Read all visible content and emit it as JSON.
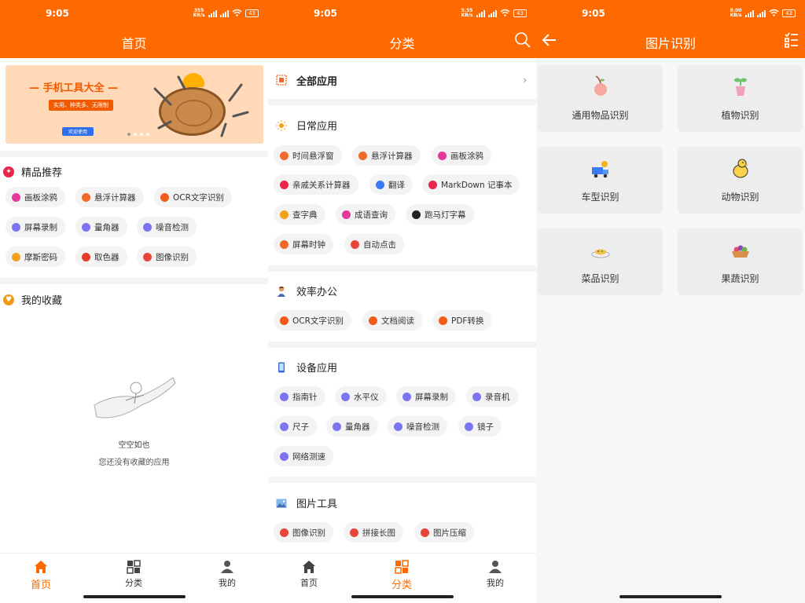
{
  "status": {
    "time": "9:05",
    "net1": "355 KB/s",
    "net2": "5.55 KB/s",
    "net3": "8.00 KB/s",
    "battery": "43"
  },
  "home": {
    "title": "首页",
    "banner": {
      "title": "— 手机工具大全 —",
      "subtitle": "实用、种类多、无限制",
      "button": "欢迎使用"
    },
    "featured": {
      "title": "精品推荐",
      "items": [
        {
          "label": "画板涂鸦",
          "color": "#e8379a"
        },
        {
          "label": "悬浮计算器",
          "color": "#f26a2a"
        },
        {
          "label": "OCR文字识别",
          "color": "#f25a1a"
        },
        {
          "label": "屏幕录制",
          "color": "#7b73f0"
        },
        {
          "label": "量角器",
          "color": "#7b73f0"
        },
        {
          "label": "噪音检测",
          "color": "#7b73f0"
        },
        {
          "label": "摩斯密码",
          "color": "#f2a21a"
        },
        {
          "label": "取色器",
          "color": "#e83a2a"
        },
        {
          "label": "图像识别",
          "color": "#e8453a"
        }
      ]
    },
    "favorites": {
      "title": "我的收藏",
      "empty_title": "空空如也",
      "empty_desc": "您还没有收藏的应用"
    }
  },
  "category": {
    "title": "分类",
    "all_apps": "全部应用",
    "chevron": "›",
    "sections": [
      {
        "title": "日常应用",
        "items": [
          {
            "label": "时间悬浮窗",
            "color": "#f26a2a"
          },
          {
            "label": "悬浮计算器",
            "color": "#f26a2a"
          },
          {
            "label": "画板涂鸦",
            "color": "#e8379a"
          },
          {
            "label": "亲戚关系计算器",
            "color": "#e8254a"
          },
          {
            "label": "翻译",
            "color": "#3a7af2"
          },
          {
            "label": "MarkDown 记事本",
            "color": "#e8254a"
          },
          {
            "label": "查字典",
            "color": "#f2a21a"
          },
          {
            "label": "成语查询",
            "color": "#e8379a"
          },
          {
            "label": "跑马灯字幕",
            "color": "#222222"
          },
          {
            "label": "屏幕时钟",
            "color": "#f26a2a"
          },
          {
            "label": "自动点击",
            "color": "#e8453a"
          }
        ]
      },
      {
        "title": "效率办公",
        "items": [
          {
            "label": "OCR文字识别",
            "color": "#f25a1a"
          },
          {
            "label": "文档阅读",
            "color": "#f25a1a"
          },
          {
            "label": "PDF转换",
            "color": "#f25a1a"
          }
        ]
      },
      {
        "title": "设备应用",
        "items": [
          {
            "label": "指南针",
            "color": "#7b73f0"
          },
          {
            "label": "水平仪",
            "color": "#7b73f0"
          },
          {
            "label": "屏幕录制",
            "color": "#7b73f0"
          },
          {
            "label": "录音机",
            "color": "#7b73f0"
          },
          {
            "label": "尺子",
            "color": "#7b73f0"
          },
          {
            "label": "量角器",
            "color": "#7b73f0"
          },
          {
            "label": "噪音检测",
            "color": "#7b73f0"
          },
          {
            "label": "镜子",
            "color": "#7b73f0"
          },
          {
            "label": "网络测速",
            "color": "#7b73f0"
          }
        ]
      },
      {
        "title": "图片工具",
        "items": [
          {
            "label": "图像识别",
            "color": "#e8453a"
          },
          {
            "label": "拼接长图",
            "color": "#e8453a"
          },
          {
            "label": "图片压缩",
            "color": "#e8453a"
          }
        ]
      }
    ]
  },
  "recognize": {
    "title": "图片识别",
    "cards": [
      {
        "label": "通用物品识别",
        "icon": "peach-icon"
      },
      {
        "label": "植物识别",
        "icon": "plant-icon"
      },
      {
        "label": "车型识别",
        "icon": "truck-icon"
      },
      {
        "label": "动物识别",
        "icon": "duck-icon"
      },
      {
        "label": "菜品识别",
        "icon": "dish-icon"
      },
      {
        "label": "果蔬识别",
        "icon": "fruit-basket-icon"
      }
    ]
  },
  "tabs": [
    {
      "label": "首页",
      "icon": "home-icon"
    },
    {
      "label": "分类",
      "icon": "category-icon"
    },
    {
      "label": "我的",
      "icon": "profile-icon"
    }
  ],
  "colors": {
    "brand": "#ff6a00"
  }
}
